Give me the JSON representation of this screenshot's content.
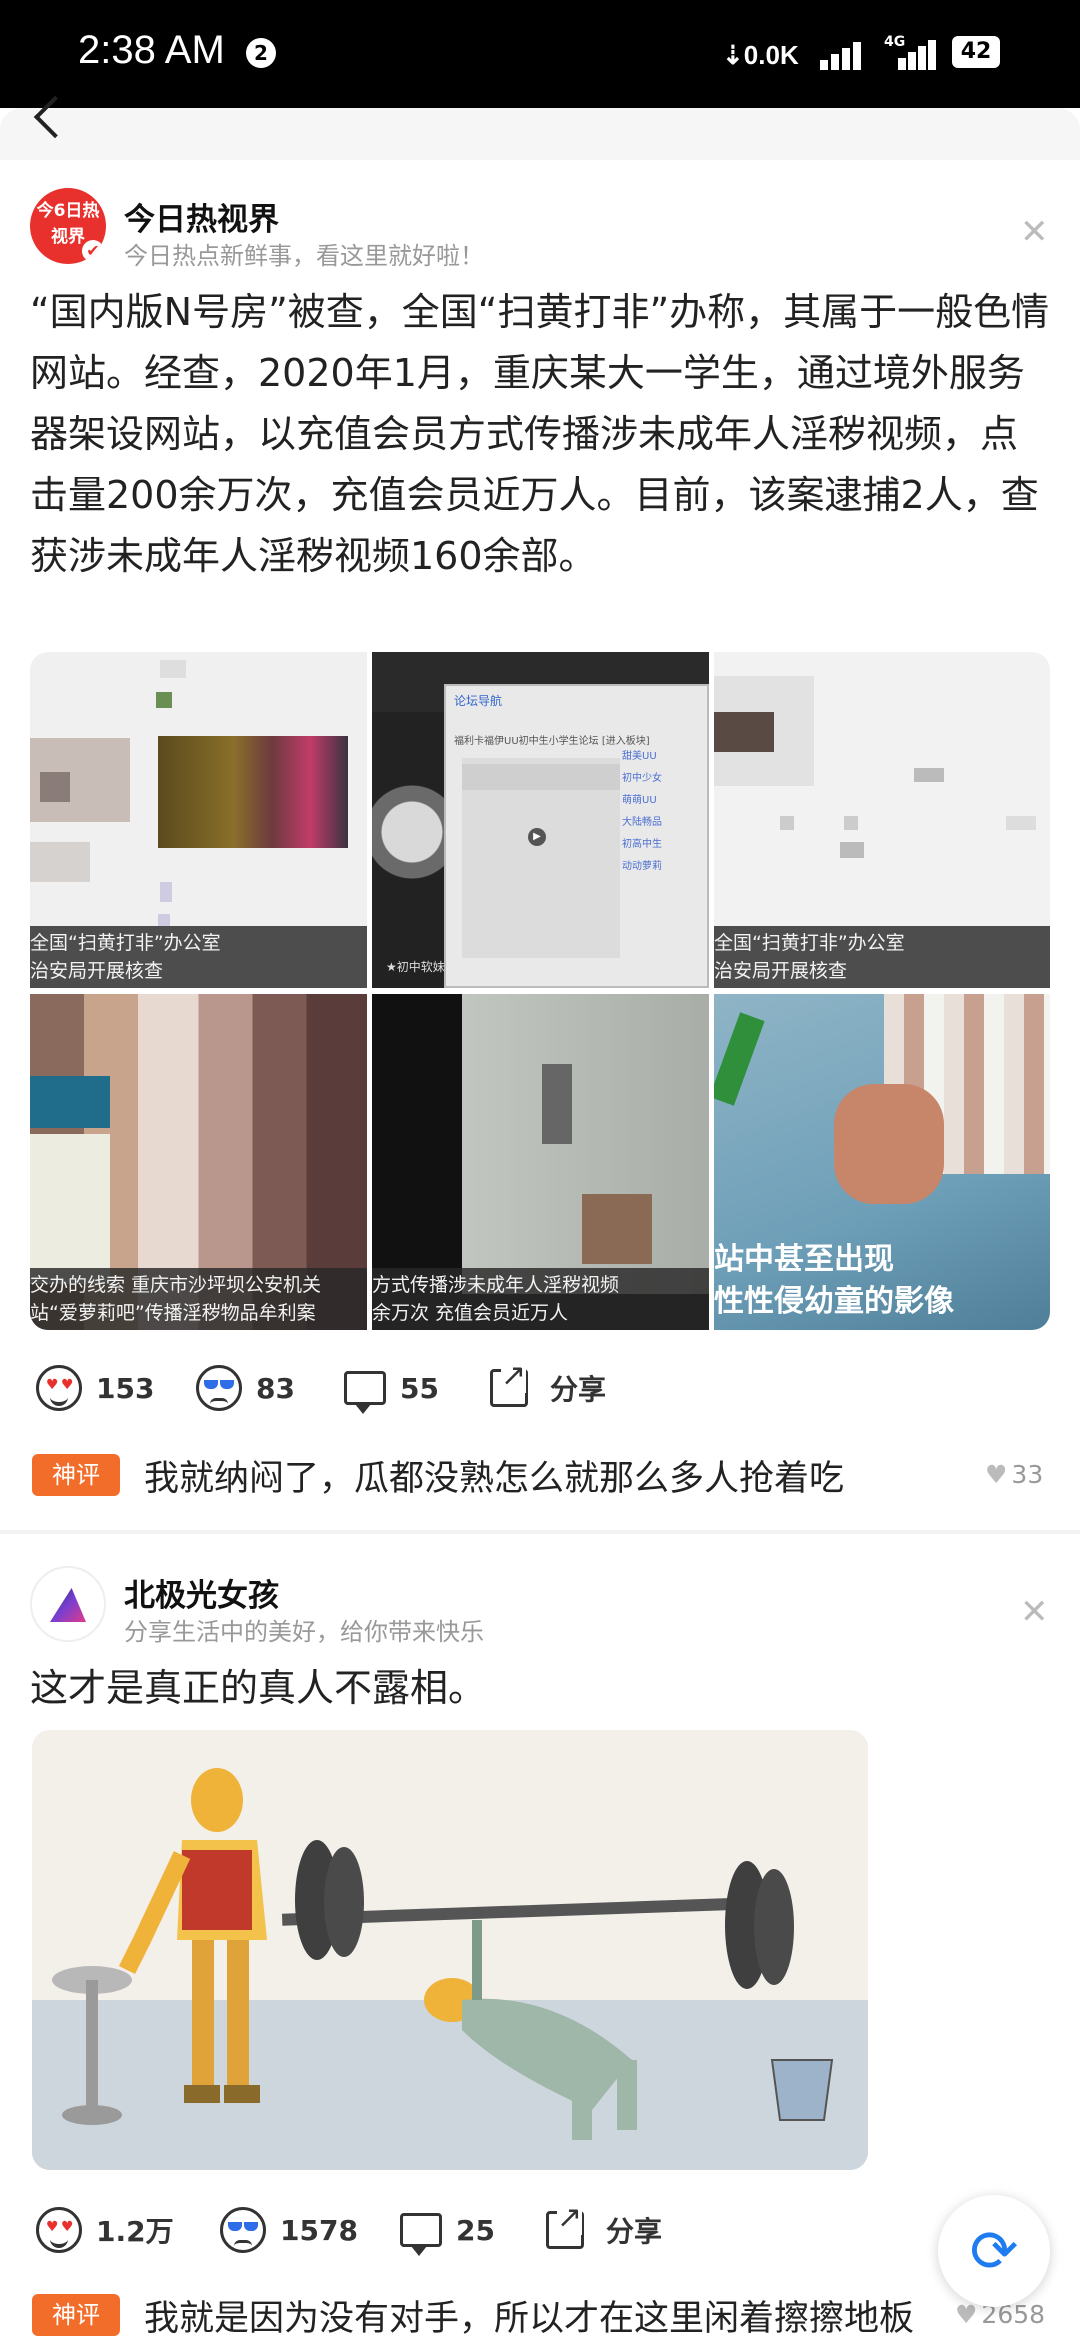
{
  "status_bar": {
    "time": "2:38 AM",
    "notification_count": "2",
    "net_speed": "0.0K",
    "network_type": "4G",
    "battery": "42"
  },
  "posts": [
    {
      "author": "今日热视界",
      "avatar_text": "今6日热视界",
      "subtitle": "今日热点新鲜事，看这里就好啦！",
      "body": "“国内版N号房”被查，全国“扫黄打非”办称，其属于一般色情网站。经查，2020年1月，重庆某大一学生，通过境外服务器架设网站，以充值会员方式传播涉未成年人淫秽视频，点击量200余万次，充值会员近万人。目前，该案逮捕2人，查获涉未成年人淫秽视频160余部。",
      "images": [
        {
          "caption_lines": [
            "全国“扫黄打非”办公室",
            "治安局开展核查"
          ]
        },
        {
          "overlay_title": "论坛导航",
          "overlay_sub": "福利卡福伊UU初中生小学生论坛 [进入板块]",
          "menu_items": [
            "甜美UU",
            "初中少女",
            "萌萌UU",
            "大陆畅品",
            "初高中生",
            "动动萝莉"
          ],
          "watermark": "★初中软妹"
        },
        {
          "caption_lines": [
            "全国“扫黄打非”办公室",
            "治安局开展核查"
          ]
        },
        {
          "caption_lines": [
            "交办的线索 重庆市沙坪坝公安机关",
            "站“爱萝莉吧”传播淫秽物品牟利案"
          ]
        },
        {
          "caption_lines": [
            "方式传播涉未成年人淫秽视频",
            "余万次 充值会员近万人"
          ]
        },
        {
          "caption_lines": [
            "站中甚至出现",
            "性性侵幼童的影像"
          ]
        }
      ],
      "actions": {
        "like": "153",
        "dislike": "83",
        "comments": "55",
        "share": "分享"
      },
      "hot_comment": {
        "badge": "神评",
        "text": "我就纳闷了，瓜都没熟怎么就那么多人抢着吃",
        "likes": "33"
      }
    },
    {
      "author": "北极光女孩",
      "subtitle": "分享生活中的美好，给你带来快乐",
      "body": "这才是真正的真人不露相。",
      "actions": {
        "like": "1.2万",
        "dislike": "1578",
        "comments": "25",
        "share": "分享"
      },
      "hot_comment": {
        "badge": "神评",
        "text": "我就是因为没有对手，所以才在这里闲着擦擦地板",
        "likes": "2658"
      }
    }
  ],
  "icons": {
    "close": "close-icon",
    "like": "heart-eyes-icon",
    "dislike": "cool-face-icon",
    "comment": "comment-icon",
    "share": "share-icon",
    "refresh": "refresh-icon"
  },
  "colors": {
    "hot_badge": "#f36d2a",
    "refresh": "#1e7bf0"
  }
}
